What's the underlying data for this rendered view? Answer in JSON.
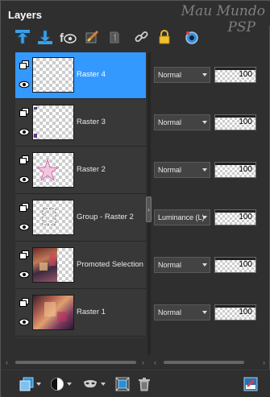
{
  "panel": {
    "title": "Layers",
    "watermark_line1": "Mau Mundo",
    "watermark_line2": "PSP"
  },
  "toolbar": {
    "icons": [
      "move-up-icon",
      "move-down-icon",
      "visibility-toggle-icon",
      "brush-icon",
      "lock-transparency-icon",
      "link-icon",
      "lock-icon",
      "view-icon"
    ]
  },
  "layers": [
    {
      "name": "Raster 4",
      "blend": "Normal",
      "opacity": "100",
      "opacity_value": 100,
      "selected": true,
      "thumb": "empty"
    },
    {
      "name": "Raster 3",
      "blend": "Normal",
      "opacity": "100",
      "opacity_value": 100,
      "selected": false,
      "thumb": "specks"
    },
    {
      "name": "Raster 2",
      "blend": "Normal",
      "opacity": "100",
      "opacity_value": 100,
      "selected": false,
      "thumb": "star"
    },
    {
      "name": "Group - Raster 2",
      "blend": "Luminance (L)",
      "opacity": "100",
      "opacity_value": 100,
      "selected": false,
      "thumb": "group"
    },
    {
      "name": "Promoted Selection",
      "blend": "Normal",
      "opacity": "100",
      "opacity_value": 100,
      "selected": false,
      "thumb": "photo"
    },
    {
      "name": "Raster 1",
      "blend": "Normal",
      "opacity": "100",
      "opacity_value": 100,
      "selected": false,
      "thumb": "photo2"
    }
  ],
  "bottom_toolbar": {
    "icons": [
      "new-layer-icon",
      "new-mask-icon",
      "mask-icon",
      "merge-icon",
      "delete-icon",
      "edit-mode-icon"
    ]
  },
  "colors": {
    "selected_row": "#3399ff",
    "panel_bg": "#2f2f2f",
    "row_bg": "#383838"
  }
}
